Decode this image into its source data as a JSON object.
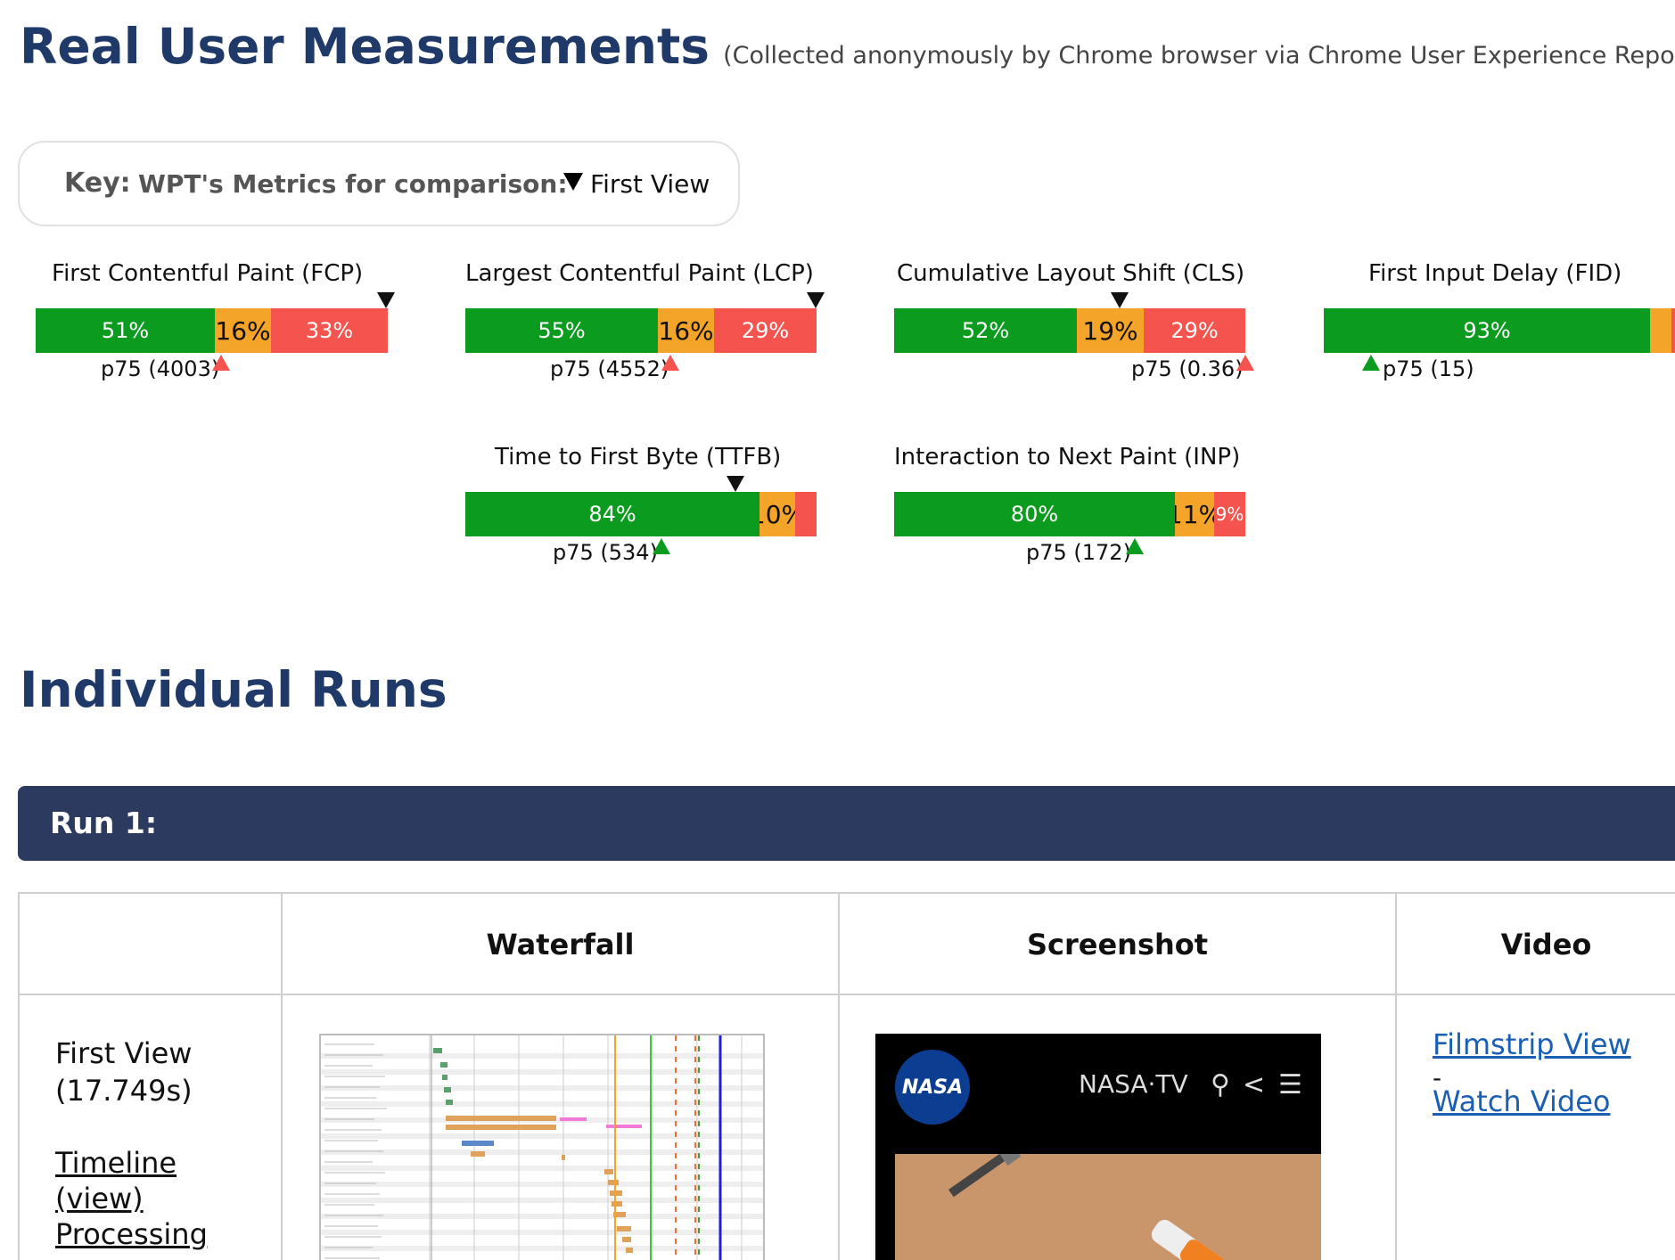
{
  "header": {
    "title": "Real User Measurements",
    "subtitle": "(Collected anonymously by Chrome browser via Chrome User Experience Report.)"
  },
  "key": {
    "label": "Key:",
    "text": "WPT's Metrics for comparison:",
    "first_view": "First View"
  },
  "metrics": [
    {
      "title": "First Contentful Paint (FCP)",
      "good": "51%",
      "mid": "16%",
      "bad": "33%",
      "good_frac": 0.51,
      "mid_frac": 0.16,
      "bad_frac": 0.33,
      "p75": "p75 (4003)",
      "p75_status": "bad"
    },
    {
      "title": "Largest Contentful Paint (LCP)",
      "good": "55%",
      "mid": "16%",
      "bad": "29%",
      "good_frac": 0.55,
      "mid_frac": 0.16,
      "bad_frac": 0.29,
      "p75": "p75 (4552)",
      "p75_status": "bad"
    },
    {
      "title": "Cumulative Layout Shift (CLS)",
      "good": "52%",
      "mid": "19%",
      "bad": "29%",
      "good_frac": 0.52,
      "mid_frac": 0.19,
      "bad_frac": 0.29,
      "p75": "p75 (0.36)",
      "p75_status": "bad"
    },
    {
      "title": "First Input Delay (FID)",
      "good": "93%",
      "p75": "p75 (15)",
      "p75_status": "good"
    },
    {
      "title": "Time to First Byte (TTFB)",
      "good": "84%",
      "mid": "10%",
      "good_frac": 0.84,
      "mid_frac": 0.1,
      "bad_frac": 0.06,
      "p75": "p75 (534)",
      "p75_status": "good"
    },
    {
      "title": "Interaction to Next Paint (INP)",
      "good": "80%",
      "mid": "11%",
      "bad": "9%",
      "good_frac": 0.8,
      "mid_frac": 0.11,
      "bad_frac": 0.09,
      "p75": "p75 (172)",
      "p75_status": "good"
    }
  ],
  "runs": {
    "title": "Individual Runs",
    "run_label": "Run 1:",
    "columns": [
      "Waterfall",
      "Screenshot",
      "Video"
    ],
    "first_view_label": "First View",
    "first_view_time": "(17.749s)",
    "timeline_link": "Timeline",
    "view_link": "(view)",
    "processing_link": "Processing",
    "filmstrip_link": "Filmstrip View",
    "separator": "-",
    "watch_video_link": "Watch Video",
    "screenshot": {
      "logo": "NASA",
      "channel": "NASA·TV"
    }
  },
  "colors": {
    "good": "#0b9b1e",
    "needs_improvement": "#f4a428",
    "poor": "#f5534e",
    "heading": "#1f3a68",
    "run_bar": "#2c3a5f",
    "link": "#1a5fb4"
  },
  "icons": [
    "first-view-marker-icon",
    "p75-arrow-icon",
    "search-icon",
    "share-icon",
    "menu-icon"
  ]
}
